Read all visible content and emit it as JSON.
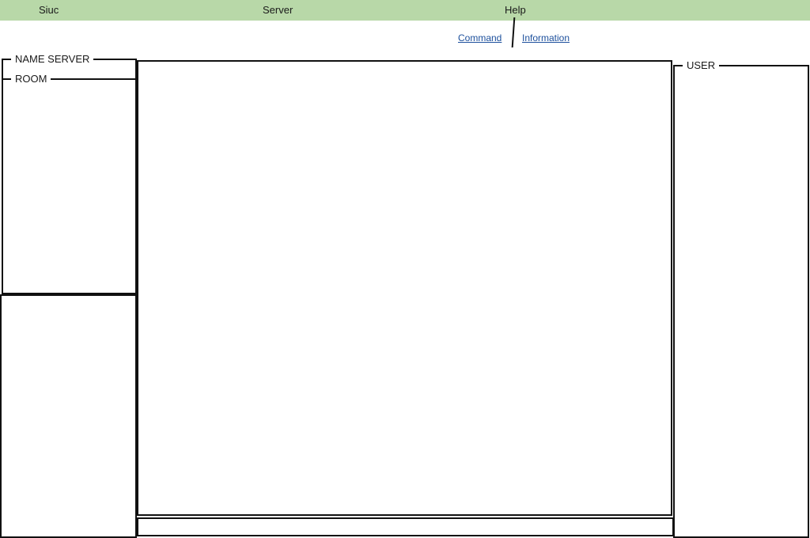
{
  "menubar": {
    "items": [
      {
        "label": "Siuc"
      },
      {
        "label": "Server"
      },
      {
        "label": "Help"
      }
    ]
  },
  "submenu": {
    "command_label": "Command",
    "information_label": "Information"
  },
  "panels": {
    "name_server_title": "NAME SERVER",
    "room_title": "ROOM",
    "user_title": "USER"
  },
  "colors": {
    "menubar_bg": "#b8d8a8",
    "link": "#1c4f9c",
    "border": "#111111"
  }
}
